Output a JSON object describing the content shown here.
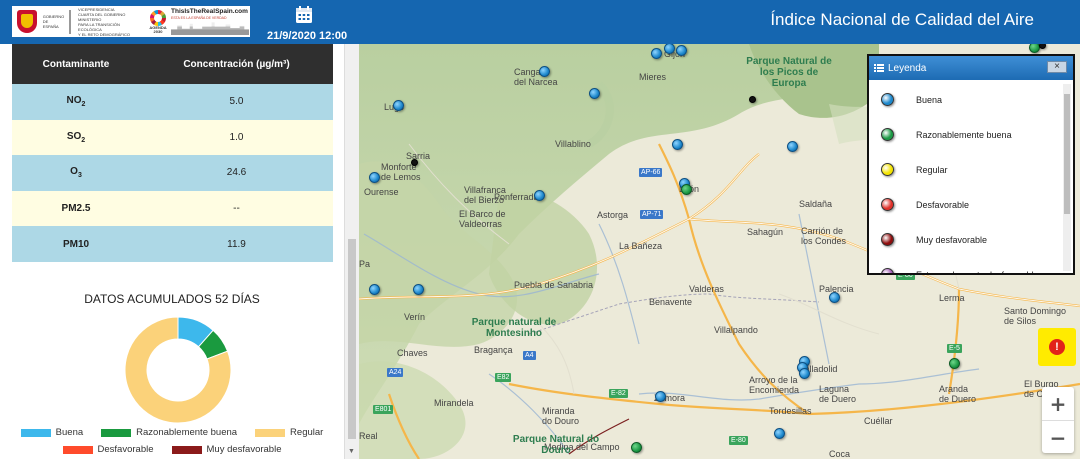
{
  "header": {
    "title": "Índice Nacional de Calidad del Aire",
    "datetime": "21/9/2020 12:00",
    "logo_gov_lines": [
      "GOBIERNO",
      "DE ESPAÑA"
    ],
    "logo_ministry_lines": [
      "VICEPRESIDENCIA",
      "CUARTA DEL GOBIERNO",
      "MINISTERIO",
      "PARA LA TRANSICIÓN ECOLÓGICA",
      "Y EL RETO DEMOGRÁFICO"
    ],
    "logo_agenda": "AGENDA 2030",
    "logo_real_title": "ThisIsTheRealSpain.com",
    "logo_real_sub": "ESTA ES LA ESPAÑA DE VERDAD"
  },
  "pollutant_table": {
    "col_pollutant": "Contaminante",
    "col_concentration": "Concentración (µg/m³)",
    "rows": [
      {
        "name": "NO",
        "sub": "2",
        "value": "5.0"
      },
      {
        "name": "SO",
        "sub": "2",
        "value": "1.0"
      },
      {
        "name": "O",
        "sub": "3",
        "value": "24.6"
      },
      {
        "name": "PM2.5",
        "sub": "",
        "value": "--"
      },
      {
        "name": "PM10",
        "sub": "",
        "value": "11.9"
      }
    ]
  },
  "accumulated": {
    "title": "DATOS ACUMULADOS 52 DÍAS",
    "legend": [
      {
        "label": "Buena",
        "color": "#3db8ec"
      },
      {
        "label": "Razonablemente buena",
        "color": "#1a9a3f"
      },
      {
        "label": "Regular",
        "color": "#fbd27a"
      },
      {
        "label": "Desfavorable",
        "color": "#ff4b2b"
      },
      {
        "label": "Muy desfavorable",
        "color": "#8b1a1a"
      }
    ]
  },
  "chart_data": {
    "type": "pie",
    "title": "DATOS ACUMULADOS 52 DÍAS",
    "categories": [
      "Buena",
      "Razonablemente buena",
      "Regular",
      "Desfavorable",
      "Muy desfavorable"
    ],
    "values": [
      6,
      4,
      42,
      0,
      0
    ],
    "colors": [
      "#3db8ec",
      "#1a9a3f",
      "#fbd27a",
      "#ff4b2b",
      "#8b1a1a"
    ],
    "legend": "bottom"
  },
  "map_legend": {
    "title": "Leyenda",
    "close_label": "×",
    "items": [
      {
        "label": "Buena",
        "color": "#1d88cc"
      },
      {
        "label": "Razonablemente buena",
        "color": "#1c9a45"
      },
      {
        "label": "Regular",
        "color": "#f4e400"
      },
      {
        "label": "Desfavorable",
        "color": "#e0312a"
      },
      {
        "label": "Muy desfavorable",
        "color": "#8e0e0e"
      },
      {
        "label": "Extremadamente desfavorable",
        "color": "#a35bb5"
      }
    ]
  },
  "map": {
    "places": [
      "Villablino",
      "Cangas del Narcea",
      "Mieres",
      "Gijón",
      "Lugo",
      "Sarria",
      "Monforte de Lemos",
      "Ponferrada",
      "Villafranca del Bierzo",
      "El Barco de Valdeorras",
      "Astorga",
      "León",
      "La Bañeza",
      "Sahagún",
      "Carrión de los Condes",
      "Saldaña",
      "Benavente",
      "Valderas",
      "Puebla de Sanabria",
      "Verín",
      "Chaves",
      "Bragança",
      "Palencia",
      "Villalpando",
      "Valladolid",
      "Arroyo de la Encomienda",
      "Laguna de Duero",
      "Tordesillas",
      "Zamora",
      "Mirandela",
      "Miranda do Douro",
      "Medina del Campo",
      "Aranda de Duero",
      "El Burgo de Osma",
      "Cuéllar",
      "Lerma",
      "Santo Domingo de Silos",
      "Coca",
      "Real",
      "Pa",
      "Ourense"
    ],
    "parks": [
      "Parque Natural de los Picos de Europa",
      "Parque natural de Montesinho",
      "Parque Natural do Douro"
    ],
    "roads": [
      "AP-66",
      "AP-71",
      "A4",
      "A24",
      "E82",
      "E801",
      "E-82",
      "E-80",
      "E-5",
      "E-80"
    ],
    "alert_icon": "!",
    "zoom_in": "+",
    "zoom_out": "−"
  }
}
